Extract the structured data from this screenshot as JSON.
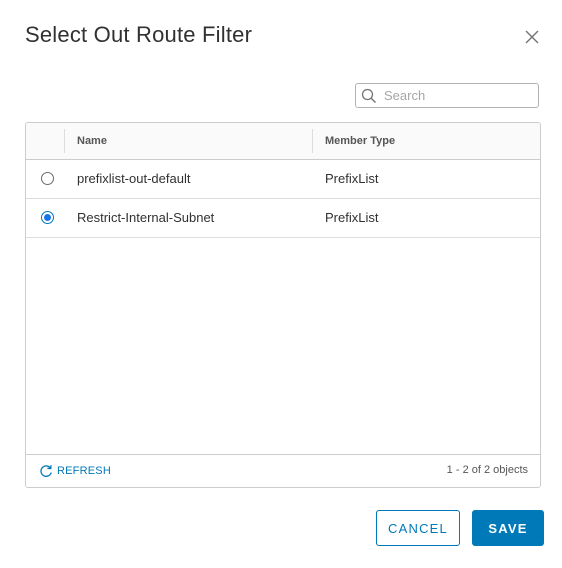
{
  "dialog": {
    "title": "Select Out Route Filter"
  },
  "search": {
    "placeholder": "Search",
    "value": ""
  },
  "grid": {
    "columns": [
      "",
      "Name",
      "Member Type"
    ],
    "rows": [
      {
        "name": "prefixlist-out-default",
        "member_type": "PrefixList",
        "selected": false
      },
      {
        "name": "Restrict-Internal-Subnet",
        "member_type": "PrefixList",
        "selected": true
      }
    ],
    "footer": {
      "refresh_label": "REFRESH",
      "count_text": "1 - 2 of 2 objects"
    }
  },
  "buttons": {
    "cancel_label": "CANCEL",
    "save_label": "SAVE"
  },
  "colors": {
    "accent": "#0079b8",
    "radio_selected": "#1a73e8",
    "text": "#313131",
    "border": "#cccccc"
  },
  "icons": {
    "close": "close-icon",
    "search": "search-icon",
    "refresh": "refresh-icon"
  }
}
